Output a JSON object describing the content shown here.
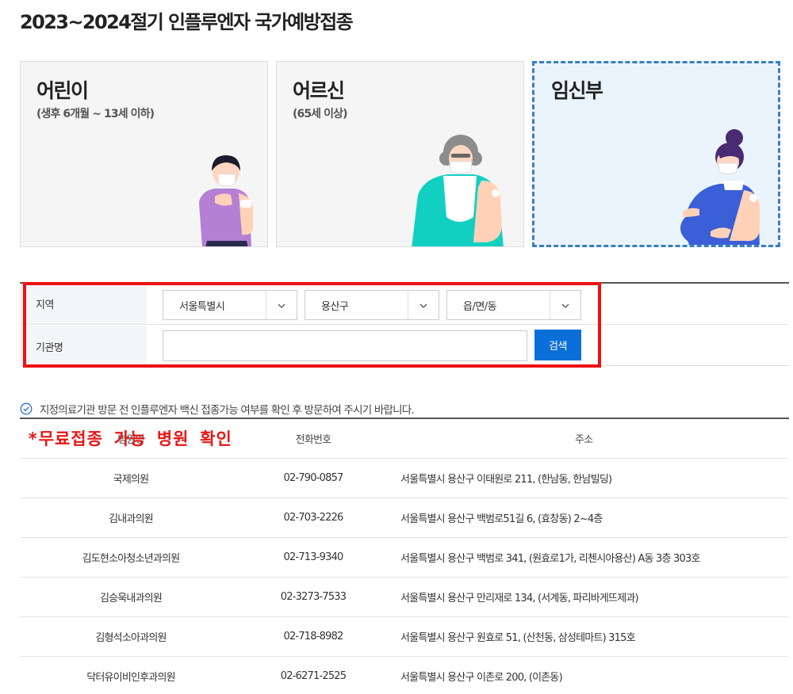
{
  "page": {
    "title": "2023~2024절기 인플루엔자 국가예방접종"
  },
  "categories": [
    {
      "title": "어린이",
      "subtitle": "(생후 6개월 ~ 13세 이하)",
      "selected": false
    },
    {
      "title": "어르신",
      "subtitle": "(65세 이상)",
      "selected": false
    },
    {
      "title": "임신부",
      "subtitle": "",
      "selected": true
    }
  ],
  "search": {
    "region_label": "지역",
    "city": "서울특별시",
    "district": "용산구",
    "town": "읍/면/동",
    "name_label": "기관명",
    "name_value": "",
    "button_label": "검색"
  },
  "notice": {
    "text": "지정의료기관 방문 전 인플루엔자 백신 접종가능 여부를 확인 후 방문하여 주시기 바랍니다."
  },
  "annotation": {
    "text": "*무료접종 가능 병원 확인"
  },
  "table": {
    "headers": [
      "병원명",
      "전화번호",
      "주소"
    ],
    "rows": [
      {
        "name": "국제의원",
        "phone": "02-790-0857",
        "address": "서울특별시 용산구 이태원로 211, (한남동, 한남빌딩)"
      },
      {
        "name": "김내과의원",
        "phone": "02-703-2226",
        "address": "서울특별시 용산구 백범로51길 6, (효창동) 2~4층"
      },
      {
        "name": "김도현소아청소년과의원",
        "phone": "02-713-9340",
        "address": "서울특별시 용산구 백범로 341, (원효로1가, 리첸시아용산) A동 3층 303호"
      },
      {
        "name": "김승욱내과의원",
        "phone": "02-3273-7533",
        "address": "서울특별시 용산구 만리재로 134, (서계동, 파리바게뜨제과)"
      },
      {
        "name": "김형석소아과의원",
        "phone": "02-718-8982",
        "address": "서울특별시 용산구 원효로 51, (산천동, 삼성테마트) 315호"
      },
      {
        "name": "닥터유이비인후과의원",
        "phone": "02-6271-2525",
        "address": "서울특별시 용산구 이촌로 200, (이촌동)"
      }
    ]
  },
  "colors": {
    "accent": "#0a6fd8",
    "highlight": "#ee1111",
    "selected_border": "#3a7ec0"
  }
}
